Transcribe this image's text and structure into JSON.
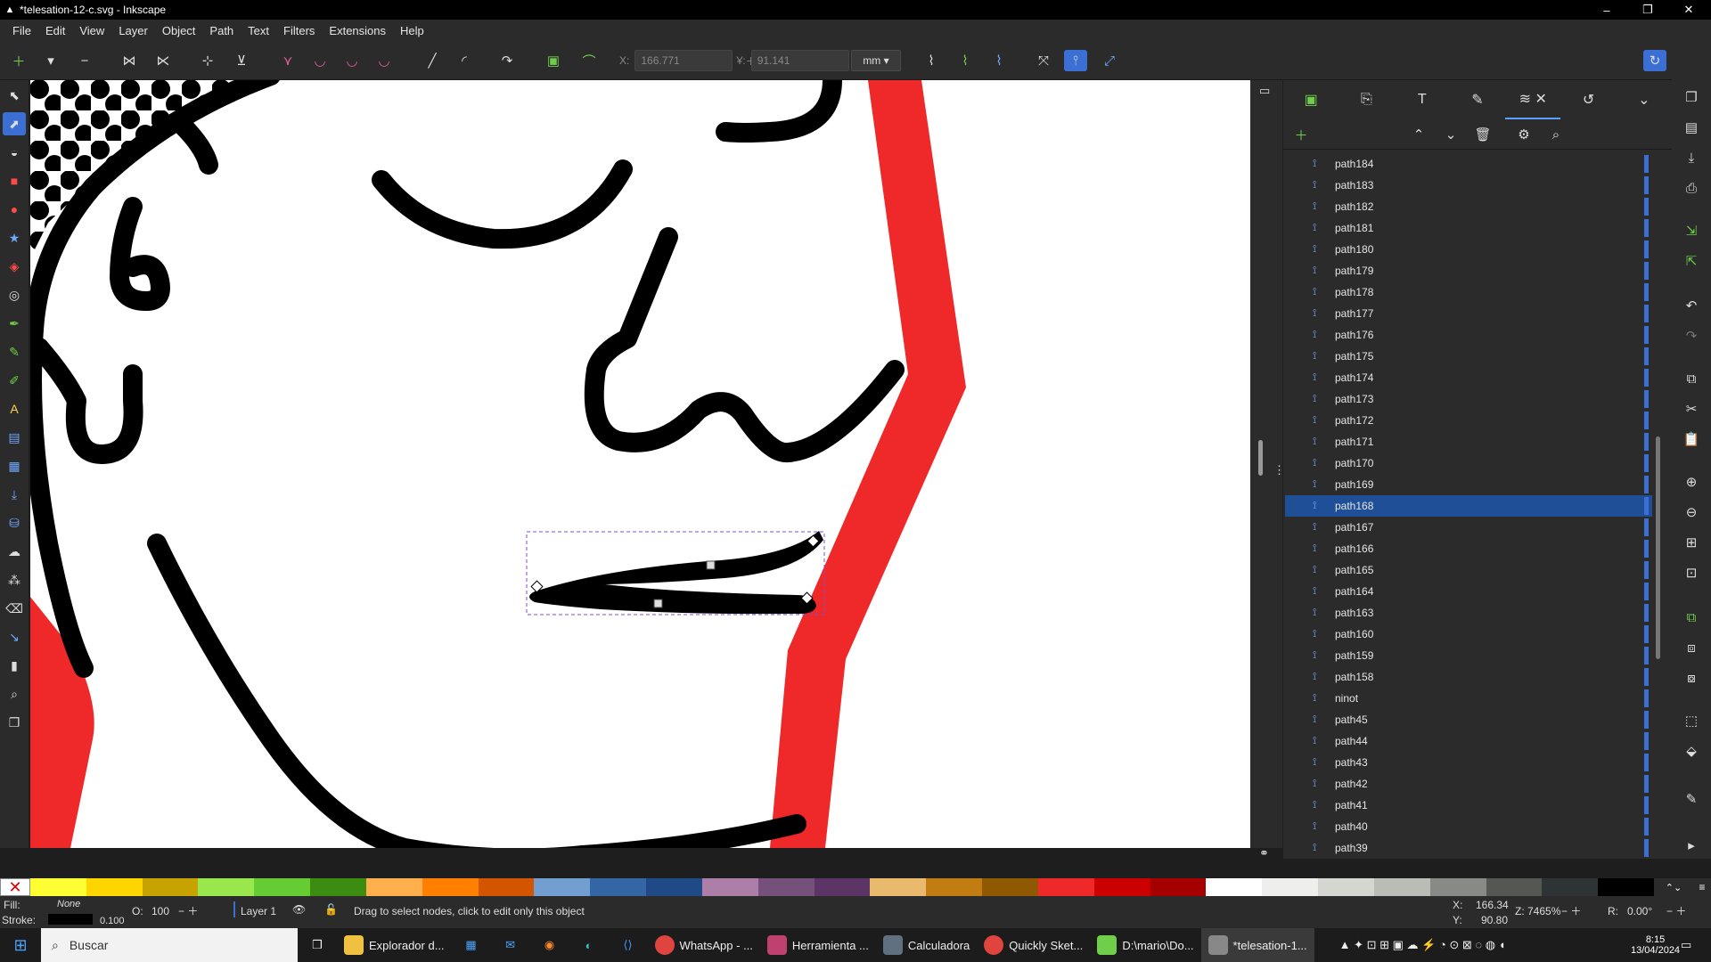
{
  "window": {
    "title": "*telesation-12-c.svg - Inkscape",
    "min": "–",
    "max": "❐",
    "close": "✕"
  },
  "menu": [
    "File",
    "Edit",
    "View",
    "Layer",
    "Object",
    "Path",
    "Text",
    "Filters",
    "Extensions",
    "Help"
  ],
  "toolbar": {
    "x_label": "X:",
    "x_value": "166.771",
    "y_label": "Y:",
    "y_value": "91.141",
    "unit": "mm"
  },
  "layers": {
    "items": [
      "path184",
      "path183",
      "path182",
      "path181",
      "path180",
      "path179",
      "path178",
      "path177",
      "path176",
      "path175",
      "path174",
      "path173",
      "path172",
      "path171",
      "path170",
      "path169",
      "path168",
      "path167",
      "path166",
      "path165",
      "path164",
      "path163",
      "path160",
      "path159",
      "path158",
      "ninot",
      "path45",
      "path44",
      "path43",
      "path42",
      "path41",
      "path40",
      "path39"
    ],
    "selected": "path168"
  },
  "status": {
    "fill_label": "Fill:",
    "fill_value": "None",
    "stroke_label": "Stroke:",
    "stroke_width": "0.100",
    "opacity_label": "O:",
    "opacity_value": "100",
    "layer": "Layer 1",
    "message": "Drag to select nodes, click to edit only this object",
    "x_label": "X:",
    "x_value": "166.34",
    "y_label": "Y:",
    "y_value": "90.80",
    "zoom_label": "Z:",
    "zoom_value": "7465%",
    "rot_label": "R:",
    "rot_value": "0.00°"
  },
  "taskbar": {
    "search": "Buscar",
    "apps": [
      "Explorador d...",
      "WhatsApp - ...",
      "Herramienta ...",
      "Calculadora",
      "Quickly Sket...",
      "D:\\mario\\Do...",
      "*telesation-1..."
    ],
    "time": "8:15",
    "date": "13/04/2024"
  },
  "palette": [
    "#ffff33",
    "#ffd500",
    "#c6a300",
    "#99e64d",
    "#66cc33",
    "#3d8c12",
    "#ffb04d",
    "#ff7f00",
    "#d45500",
    "#729fcf",
    "#3465a4",
    "#204a87",
    "#ad7fa8",
    "#75507b",
    "#5c3566",
    "#e9b96e",
    "#c17d11",
    "#8f5902",
    "#ef2929",
    "#cc0000",
    "#a40000",
    "#ffffff",
    "#eeeeec",
    "#d3d7cf",
    "#babdb6",
    "#888a85",
    "#555753",
    "#2e3436",
    "#000000"
  ]
}
